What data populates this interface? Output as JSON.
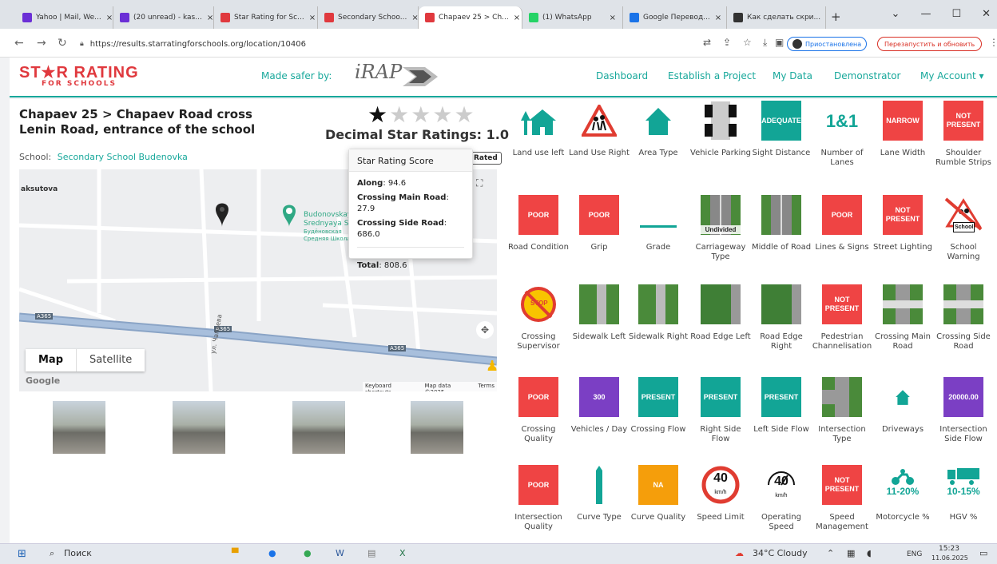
{
  "browser": {
    "tabs": [
      {
        "label": "Yahoo | Mail, We...",
        "color": "#6b2fd6"
      },
      {
        "label": "(20 unread) - kas...",
        "color": "#6b2fd6"
      },
      {
        "label": "Star Rating for Sc...",
        "color": "#e0393e"
      },
      {
        "label": "Secondary Schoo...",
        "color": "#e0393e"
      },
      {
        "label": "Chapaev 25 > Ch...",
        "color": "#e0393e"
      },
      {
        "label": "(1) WhatsApp",
        "color": "#25d366"
      },
      {
        "label": "Google Перевод...",
        "color": "#1a73e8"
      },
      {
        "label": "Как сделать скри...",
        "color": "#333333"
      }
    ],
    "active_tab": 4,
    "url": "https://results.starratingforschools.org/location/10406",
    "paused_label": "Приостановлена",
    "restart_label": "Перезапустить и обновить"
  },
  "site": {
    "logo_main": "ST★R RATING",
    "logo_sub": "FOR SCHOOLS",
    "made_safer_by": "Made safer by:",
    "partner": "iRAP",
    "nav": [
      "Dashboard",
      "Establish a Project",
      "My Data",
      "Demonstrator",
      "My Account ▾"
    ]
  },
  "location": {
    "title": "Chapaev 25 > Chapaev Road cross Lenin Road, entrance of the school",
    "school_label": "School:",
    "school_name": "Secondary School Budenovka",
    "rated_label": "Rated",
    "decimal_rating_label": "Decimal Star Ratings: 1.0",
    "stars_filled": 1,
    "stars_total": 5
  },
  "tooltip": {
    "header": "Star Rating Score",
    "rows": [
      {
        "k": "Along",
        "v": "94.6"
      },
      {
        "k": "Crossing Main Road",
        "v": "27.9"
      },
      {
        "k": "Crossing Side Road",
        "v": "686.0"
      }
    ],
    "total_k": "Total",
    "total_v": "808.6"
  },
  "map": {
    "label_place1": "aksutova",
    "label_poi": "Budonovskay",
    "label_poi2": "Srednyaya Sh",
    "label_poi3": "Будёновская",
    "label_poi4": "Средняя Школа",
    "road_a365": "A365",
    "street_vert": "ул. Чапаева",
    "toggle_map": "Map",
    "toggle_sat": "Satellite",
    "google": "Google",
    "footer": [
      "Keyboard shortcuts",
      "Map data ©2025",
      "Terms"
    ]
  },
  "attributes": [
    {
      "label": "Land use left",
      "icon": "house-tree-icon",
      "text": ""
    },
    {
      "label": "Land Use Right",
      "icon": "children-warning-icon",
      "text": ""
    },
    {
      "label": "Area Type",
      "icon": "house-icon",
      "text": ""
    },
    {
      "label": "Vehicle Parking",
      "icon": "parking-road-icon",
      "text": ""
    },
    {
      "label": "Sight Distance",
      "icon": "badge-teal",
      "text": "ADEQUATE"
    },
    {
      "label": "Number of Lanes",
      "icon": "lanes-text-icon",
      "text": "1&1"
    },
    {
      "label": "Lane Width",
      "icon": "badge-red",
      "text": "NARROW"
    },
    {
      "label": "Shoulder Rumble Strips",
      "icon": "badge-red",
      "text": "NOT PRESENT"
    },
    {
      "label": "Road Condition",
      "icon": "badge-red",
      "text": "POOR"
    },
    {
      "label": "Grip",
      "icon": "badge-red",
      "text": "POOR"
    },
    {
      "label": "Grade",
      "icon": "grade-line-icon",
      "text": ""
    },
    {
      "label": "Carriageway Type",
      "icon": "road-tile-icon",
      "text": "Undivided"
    },
    {
      "label": "Middle of Road",
      "icon": "road-tile-icon",
      "text": ""
    },
    {
      "label": "Lines & Signs",
      "icon": "badge-red",
      "text": "POOR"
    },
    {
      "label": "Street Lighting",
      "icon": "badge-red",
      "text": "NOT PRESENT"
    },
    {
      "label": "School Warning",
      "icon": "school-warning-crossed-icon",
      "text": "School"
    },
    {
      "label": "Crossing Supervisor",
      "icon": "stop-crossed-icon",
      "text": "STOP"
    },
    {
      "label": "Sidewalk Left",
      "icon": "sidewalk-tile-icon",
      "text": ""
    },
    {
      "label": "Sidewalk Right",
      "icon": "sidewalk-tile-icon",
      "text": ""
    },
    {
      "label": "Road Edge Left",
      "icon": "grass-tile-icon",
      "text": ""
    },
    {
      "label": "Road Edge Right",
      "icon": "grass-tile-icon",
      "text": ""
    },
    {
      "label": "Pedestrian Channelisation",
      "icon": "badge-red",
      "text": "NOT PRESENT"
    },
    {
      "label": "Crossing Main Road",
      "icon": "crossing-tile-icon",
      "text": ""
    },
    {
      "label": "Crossing Side Road",
      "icon": "crossing-tile-icon",
      "text": ""
    },
    {
      "label": "Crossing Quality",
      "icon": "badge-red",
      "text": "POOR"
    },
    {
      "label": "Vehicles / Day",
      "icon": "badge-purple",
      "text": "300"
    },
    {
      "label": "Crossing Flow",
      "icon": "badge-teal",
      "text": "PRESENT"
    },
    {
      "label": "Right Side Flow",
      "icon": "badge-teal",
      "text": "PRESENT"
    },
    {
      "label": "Left Side Flow",
      "icon": "badge-teal",
      "text": "PRESENT"
    },
    {
      "label": "Intersection Type",
      "icon": "intersection-tile-icon",
      "text": ""
    },
    {
      "label": "Driveways",
      "icon": "small-house-icon",
      "text": ""
    },
    {
      "label": "Intersection Side Flow",
      "icon": "badge-purple",
      "text": "20000.00"
    },
    {
      "label": "Intersection Quality",
      "icon": "badge-red",
      "text": "POOR"
    },
    {
      "label": "Curve Type",
      "icon": "curve-bar-icon",
      "text": ""
    },
    {
      "label": "Curve Quality",
      "icon": "badge-orange",
      "text": "NA"
    },
    {
      "label": "Speed Limit",
      "icon": "speed-sign-icon",
      "text": "40"
    },
    {
      "label": "Operating Speed",
      "icon": "speedometer-icon",
      "text": "40"
    },
    {
      "label": "Speed Management",
      "icon": "badge-red",
      "text": "NOT PRESENT"
    },
    {
      "label": "Motorcycle %",
      "icon": "motorcycle-icon",
      "text": "11-20%"
    },
    {
      "label": "HGV %",
      "icon": "truck-icon",
      "text": "10-15%"
    }
  ],
  "speed_unit": "km/h",
  "taskbar": {
    "search": "Поиск",
    "weather": "34°C Cloudy",
    "lang": "ENG",
    "time": "15:23",
    "date": "11.06.2025"
  }
}
